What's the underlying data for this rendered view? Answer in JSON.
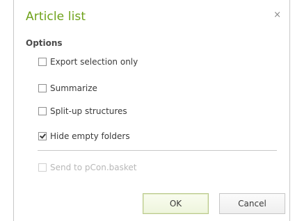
{
  "dialog": {
    "title": "Article list",
    "close_icon": "close-icon",
    "close_glyph": "×",
    "accent_color": "#6ea21a"
  },
  "options": {
    "label": "Options",
    "items": [
      {
        "label": "Export selection only",
        "checked": false,
        "enabled": true
      },
      {
        "label": "Summarize",
        "checked": false,
        "enabled": true
      },
      {
        "label": "Split-up structures",
        "checked": false,
        "enabled": true
      },
      {
        "label": "Hide empty folders",
        "checked": true,
        "enabled": true
      }
    ],
    "extra": {
      "label": "Send to pCon.basket",
      "checked": false,
      "enabled": false
    }
  },
  "buttons": {
    "ok_label": "OK",
    "cancel_label": "Cancel"
  }
}
